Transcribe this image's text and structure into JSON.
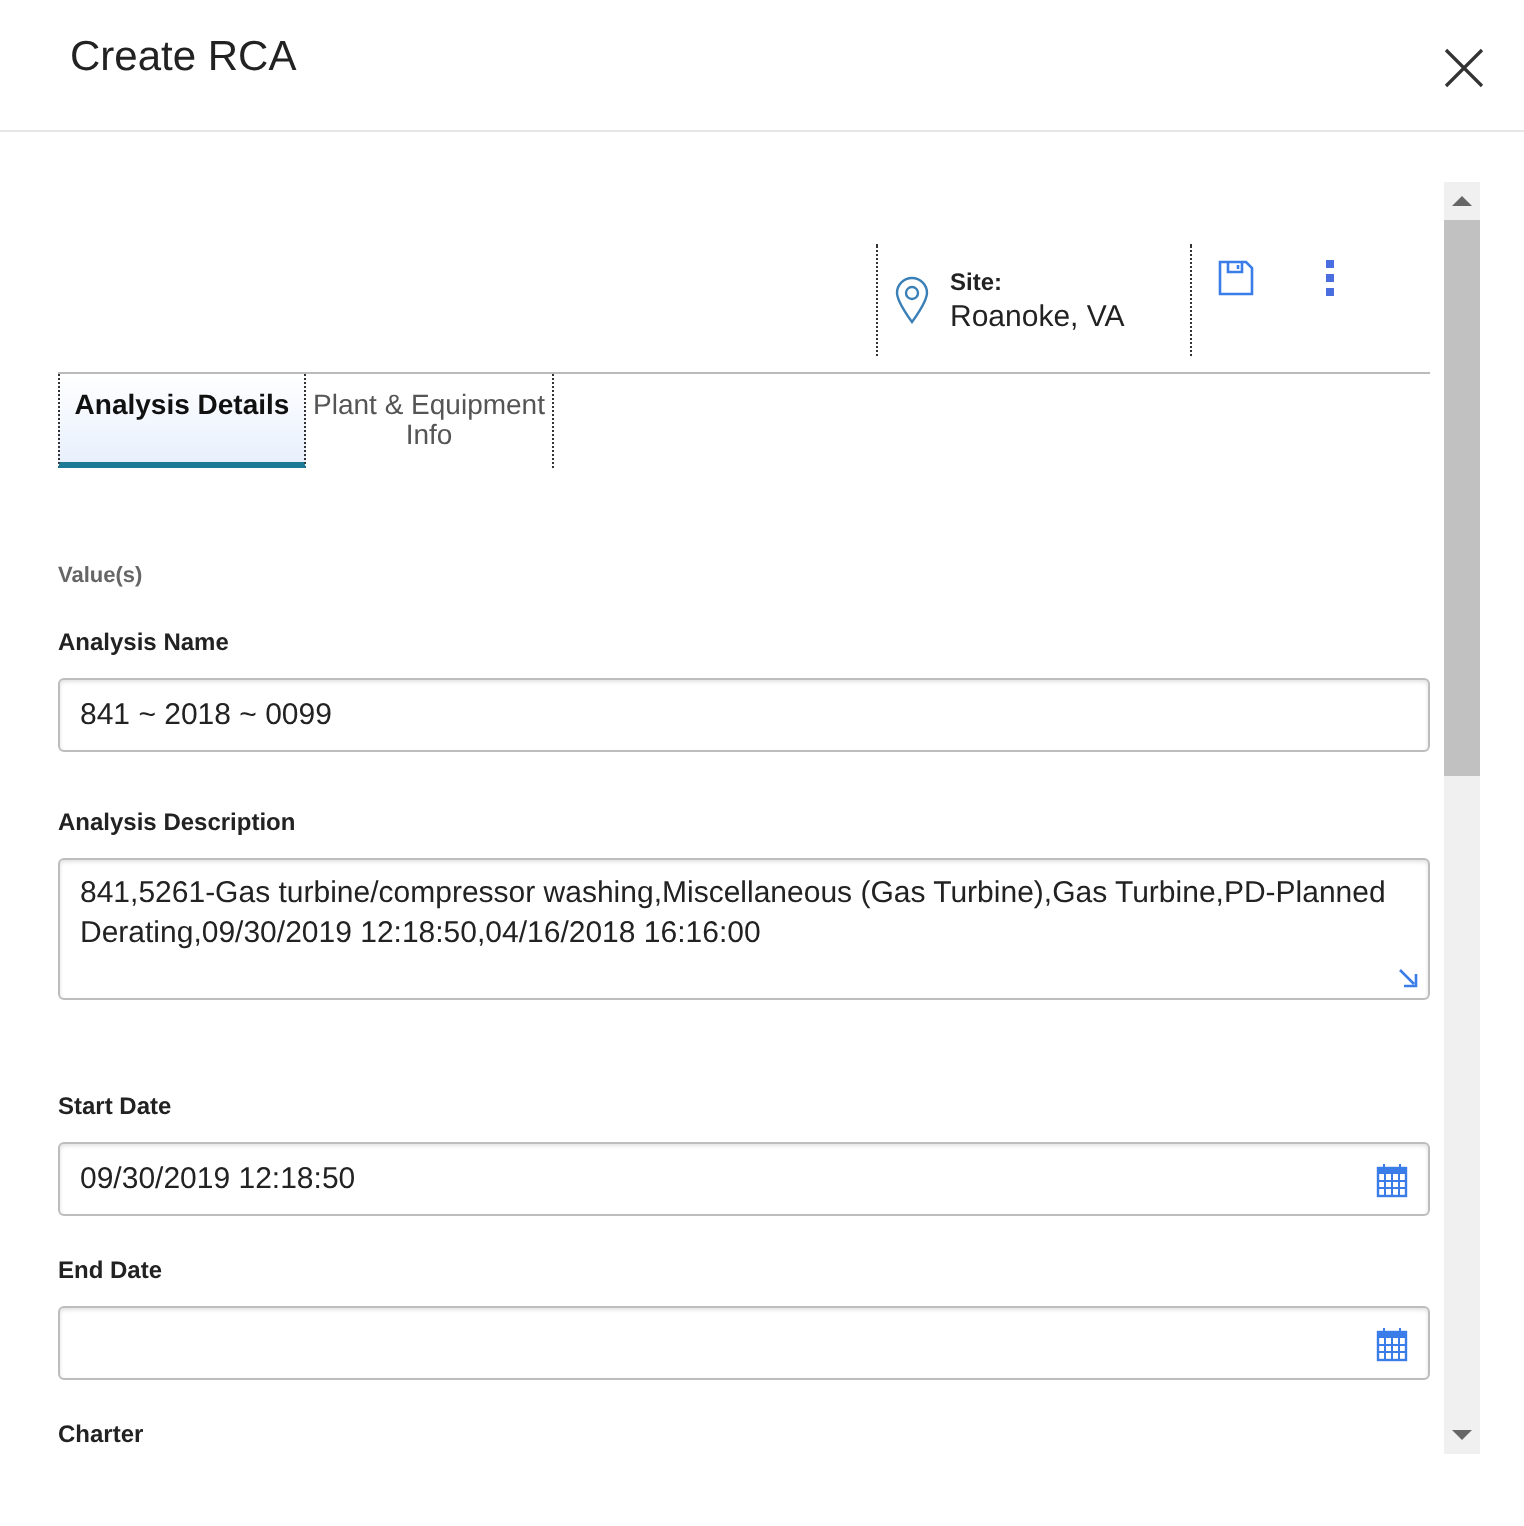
{
  "dialog": {
    "title": "Create RCA"
  },
  "toolbar": {
    "site_label": "Site:",
    "site_value": "Roanoke, VA"
  },
  "tabs": [
    {
      "label": "Analysis Details",
      "selected": true
    },
    {
      "label": "Plant & Equipment Info",
      "selected": false
    }
  ],
  "section_label": "Value(s)",
  "fields": [
    {
      "kind": "text",
      "label": "Analysis Name",
      "value": "841 ~ 2018 ~ 0099"
    },
    {
      "kind": "textarea",
      "label": "Analysis Description",
      "value": "841,5261-Gas turbine/compressor washing,Miscellaneous (Gas Turbine),Gas Turbine,PD-Planned Derating,09/30/2019 12:18:50,04/16/2018 16:16:00"
    },
    {
      "kind": "date",
      "label": "Start Date",
      "value": "09/30/2019 12:18:50"
    },
    {
      "kind": "date",
      "label": "End Date"
    },
    {
      "kind": "heading",
      "label": "Charter"
    }
  ]
}
